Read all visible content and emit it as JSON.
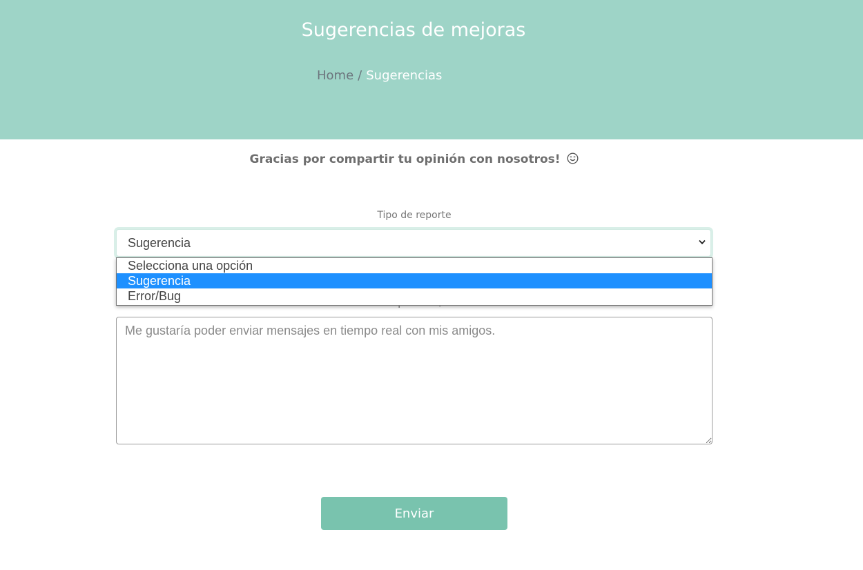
{
  "header": {
    "title": "Sugerencias de mejoras",
    "breadcrumb": {
      "home": "Home",
      "separator": "/",
      "current": "Sugerencias"
    },
    "background_color": "#9ed4c7"
  },
  "thanks_message": "Gracias por compartir tu opinión con nosotros!",
  "thanks_icon": "smiling-face-icon",
  "form": {
    "type_label": "Tipo de reporte",
    "type_selected": "Sugerencia",
    "type_options": [
      "Selecciona una opción",
      "Sugerencia",
      "Error/Bug"
    ],
    "description_label": "Descripción 64/254",
    "description_placeholder": "Me gustaría poder enviar mensajes en tiempo real con mis amigos.",
    "submit_label": "Enviar",
    "accent_color": "#79c3ae",
    "highlight_color": "#1e90ff"
  }
}
